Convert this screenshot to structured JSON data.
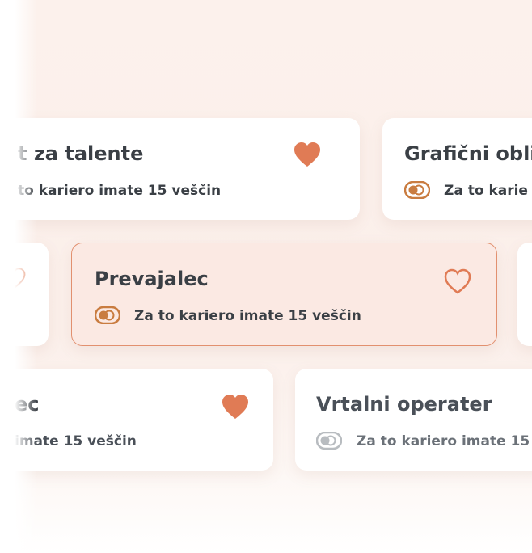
{
  "cards": {
    "row1_left": {
      "title": "t za talente",
      "subtitle": "to kariero imate 15 veščin",
      "liked": true
    },
    "row1_right": {
      "title": "Grafični obli",
      "subtitle": "Za to karie",
      "liked": false
    },
    "row2_main": {
      "title": "Prevajalec",
      "subtitle": "Za to kariero imate 15 veščin",
      "liked": false
    },
    "row3_left": {
      "title": "ec",
      "subtitle": "imate 15 veščin",
      "liked": true
    },
    "row3_right": {
      "title": "Vrtalni operater",
      "subtitle": "Za to kariero imate 15",
      "liked": false
    }
  },
  "colors": {
    "accent": "#e07b55",
    "toggle_active": "#c97c40",
    "toggle_muted": "#b8bcc0",
    "text": "#3a3f45",
    "highlight_bg": "#fbe9e3"
  },
  "icons": {
    "heart_filled": "heart-filled-icon",
    "heart_outline": "heart-outline-icon",
    "skills_toggle": "skills-toggle-icon"
  }
}
